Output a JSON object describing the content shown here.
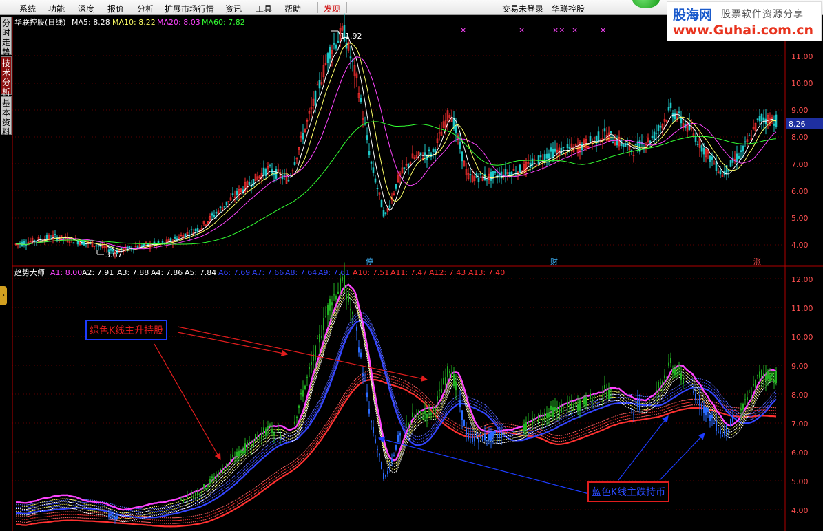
{
  "menubar": {
    "items": [
      "系统",
      "功能",
      "深度",
      "报价",
      "分析",
      "扩展市场行情",
      "资讯",
      "工具",
      "帮助"
    ],
    "discover": "发现",
    "login_status": "交易未登录",
    "stock_name": "华联控股"
  },
  "sidebar": {
    "tabs": [
      "分时走势",
      "技术分析",
      "基本资料"
    ],
    "active_index": 1
  },
  "watermark": {
    "logo": "股海网",
    "slogan": "股票软件资源分享",
    "url": "www.Guhai.com.cn"
  },
  "main_panel": {
    "title": "华联控股(日线)",
    "indicators": [
      {
        "label": "MA5: 8.28",
        "color": "#ffffff"
      },
      {
        "label": "MA10: 8.22",
        "color": "#ffff66"
      },
      {
        "label": "MA20: 8.03",
        "color": "#ff44ff"
      },
      {
        "label": "MA60: 7.82",
        "color": "#33ff33"
      }
    ],
    "high_label": "11.92",
    "low_label": "3.67",
    "current_price": "8.26",
    "y_ticks": [
      "11.00",
      "10.00",
      "9.00",
      "8.00",
      "7.00",
      "6.00",
      "5.00",
      "4.00"
    ],
    "event_markers": [
      "停",
      "财",
      "涨"
    ]
  },
  "sub_panel": {
    "title": "趋势大师",
    "indicators": [
      {
        "label": "A1: 8.00",
        "color": "#ff44ff"
      },
      {
        "label": "A2: 7.91",
        "color": "#ffffff"
      },
      {
        "label": "A3: 7.88",
        "color": "#ffffff"
      },
      {
        "label": "A4: 7.86",
        "color": "#ffffff"
      },
      {
        "label": "A5: 7.84",
        "color": "#ffffff"
      },
      {
        "label": "A6: 7.69",
        "color": "#3344ff"
      },
      {
        "label": "A7: 7.66",
        "color": "#3344ff"
      },
      {
        "label": "A8: 7.64",
        "color": "#3344ff"
      },
      {
        "label": "A9: 7.61",
        "color": "#3344ff"
      },
      {
        "label": "A10: 7.51",
        "color": "#ff3030"
      },
      {
        "label": "A11: 7.47",
        "color": "#ff3030"
      },
      {
        "label": "A12: 7.43",
        "color": "#ff3030"
      },
      {
        "label": "A13: 7.40",
        "color": "#ff3030"
      }
    ],
    "y_ticks": [
      "12.00",
      "11.00",
      "10.00",
      "9.00",
      "8.00",
      "7.00",
      "6.00",
      "5.00",
      "4.00"
    ]
  },
  "annotations": {
    "green": "绿色K线主升持股",
    "blue": "蓝色K线主跌持币"
  },
  "colors": {
    "up": "#ff3030",
    "down": "#1ec8c8",
    "grid": "#5a0000",
    "axis": "#b00000",
    "tick_text": "#ff5050"
  }
}
